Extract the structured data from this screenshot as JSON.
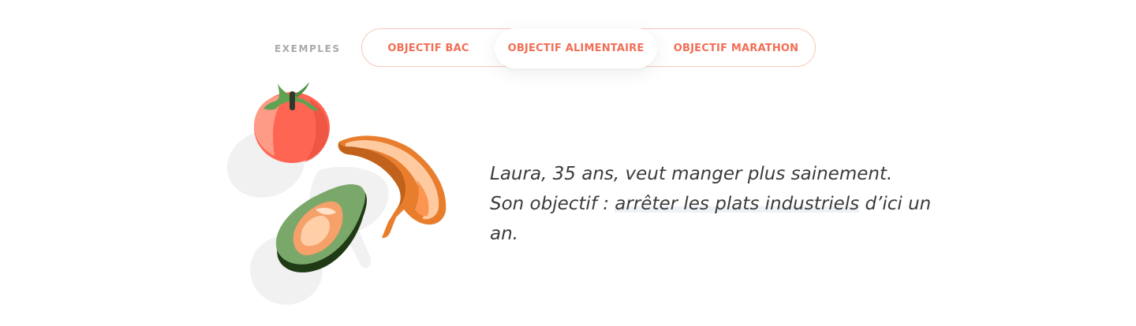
{
  "examples": {
    "label": "EXEMPLES",
    "tabs": [
      {
        "label": "OBJECTIF BAC",
        "active": false
      },
      {
        "label": "OBJECTIF ALIMENTAIRE",
        "active": true
      },
      {
        "label": "OBJECTIF MARATHON",
        "active": false
      }
    ]
  },
  "story": {
    "before": "Laura, 35 ans, veut manger plus sainement. Son objectif : ",
    "highlight": "arrêter les plats industriels",
    "after": " d’ici un an."
  },
  "colors": {
    "accent": "#f16e55",
    "tab_border": "#f5c9ba",
    "label_gray": "#a7a9ad",
    "text": "#3b3b3b"
  },
  "illustration": {
    "items": [
      "tomato",
      "banana",
      "avocado"
    ]
  }
}
